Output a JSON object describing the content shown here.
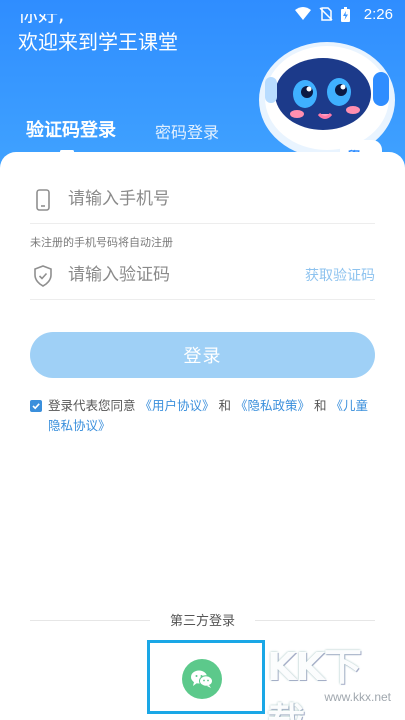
{
  "status_bar": {
    "time": "2:26",
    "icons": [
      "wifi-icon",
      "no-sim-icon",
      "battery-icon"
    ]
  },
  "header": {
    "greeting_line1": "你好,",
    "greeting_line2": "欢迎来到学王课堂"
  },
  "tabs": {
    "active": "验证码登录",
    "inactive": "密码登录"
  },
  "form": {
    "phone_placeholder": "请输入手机号",
    "phone_hint": "未注册的手机号码将自动注册",
    "code_placeholder": "请输入验证码",
    "get_code_label": "获取验证码",
    "login_label": "登录"
  },
  "agreement": {
    "checked": true,
    "prefix": "登录代表您同意",
    "user_agreement": "《用户协议》",
    "and1": "和",
    "privacy_policy": "《隐私政策》",
    "and2": "和",
    "child_privacy": "《儿童隐私协议》"
  },
  "third_party": {
    "label": "第三方登录",
    "wechat_icon": "wechat-icon"
  },
  "watermark": {
    "logo": "KK下载",
    "url": "www.kkx.net"
  },
  "colors": {
    "header_blue": "#2f8dff",
    "button_blue": "#9fd0f6",
    "link_blue": "#3a8fdc",
    "wechat_green": "#5cc98b",
    "highlight_border": "#1aa7e6"
  }
}
